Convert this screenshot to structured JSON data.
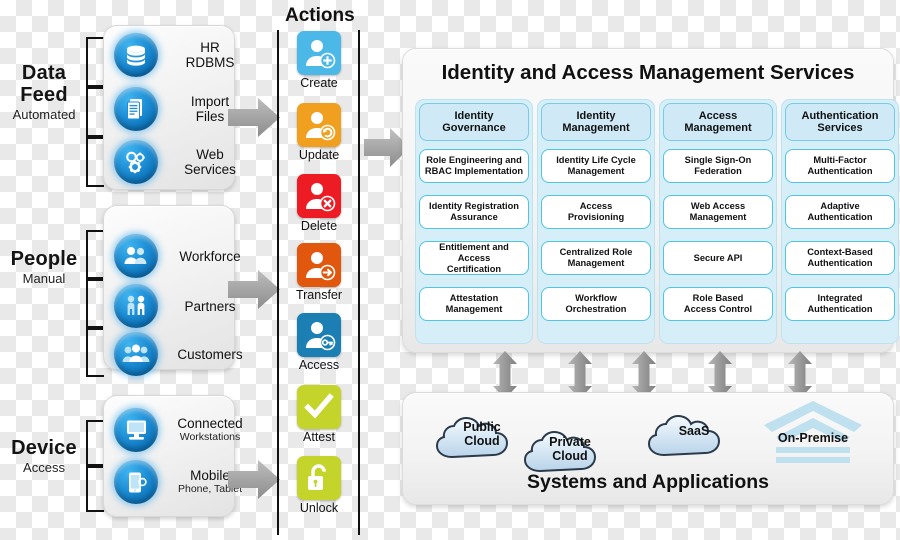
{
  "sources": [
    {
      "label": "Data Feed",
      "sublabel": "Automated",
      "items": [
        {
          "name": "HR RDBMS",
          "line1": "HR",
          "line2": "RDBMS",
          "icon": "database-icon"
        },
        {
          "name": "Import Files",
          "line1": "Import",
          "line2": "Files",
          "icon": "document-icon"
        },
        {
          "name": "Web Services",
          "line1": "Web",
          "line2": "Services",
          "icon": "gears-icon"
        }
      ]
    },
    {
      "label": "People",
      "sublabel": "Manual",
      "items": [
        {
          "name": "Workforce",
          "line1": "Workforce",
          "line2": "",
          "icon": "group-icon"
        },
        {
          "name": "Partners",
          "line1": "Partners",
          "line2": "",
          "icon": "handshake-icon"
        },
        {
          "name": "Customers",
          "line1": "Customers",
          "line2": "",
          "icon": "customers-icon"
        }
      ]
    },
    {
      "label": "Device",
      "sublabel": "Access",
      "items": [
        {
          "name": "Connected Workstations",
          "line1": "Connected",
          "line2": "Workstations",
          "icon": "workstation-icon"
        },
        {
          "name": "Mobile",
          "line1": "Mobile",
          "line2": "Phone, Tablet",
          "icon": "mobile-icon"
        }
      ]
    }
  ],
  "actions": {
    "title": "Actions",
    "items": [
      {
        "label": "Create",
        "icon": "user-add-icon",
        "color": "#4cb8e8"
      },
      {
        "label": "Update",
        "icon": "user-refresh-icon",
        "color": "#f0a01e"
      },
      {
        "label": "Delete",
        "icon": "user-delete-icon",
        "color": "#ed1c24"
      },
      {
        "label": "Transfer",
        "icon": "user-transfer-icon",
        "color": "#e2570e"
      },
      {
        "label": "Access",
        "icon": "user-key-icon",
        "color": "#1b7fb4"
      },
      {
        "label": "Attest",
        "icon": "checkmark-icon",
        "color": "#c4d42a"
      },
      {
        "label": "Unlock",
        "icon": "open-padlock-icon",
        "color": "#c4d42a"
      }
    ]
  },
  "iam": {
    "title": "Identity and Access Management Services",
    "columns": [
      {
        "head_line1": "Identity",
        "head_line2": "Governance",
        "services": [
          {
            "line1": "Role Engineering and",
            "line2": "RBAC Implementation"
          },
          {
            "line1": "Identity Registration",
            "line2": "Assurance"
          },
          {
            "line1": "Entitlement and Access",
            "line2": "Certification"
          },
          {
            "line1": "Attestation",
            "line2": "Management"
          }
        ]
      },
      {
        "head_line1": "Identity",
        "head_line2": "Management",
        "services": [
          {
            "line1": "Identity Life Cycle",
            "line2": "Management"
          },
          {
            "line1": "Access",
            "line2": "Provisioning"
          },
          {
            "line1": "Centralized Role",
            "line2": "Management"
          },
          {
            "line1": "Workflow",
            "line2": "Orchestration"
          }
        ]
      },
      {
        "head_line1": "Access",
        "head_line2": "Management",
        "services": [
          {
            "line1": "Single Sign-On",
            "line2": "Federation"
          },
          {
            "line1": "Web Access",
            "line2": "Management"
          },
          {
            "line1": "Secure API",
            "line2": ""
          },
          {
            "line1": "Role Based",
            "line2": "Access Control"
          }
        ]
      },
      {
        "head_line1": "Authentication",
        "head_line2": "Services",
        "services": [
          {
            "line1": "Multi-Factor",
            "line2": "Authentication"
          },
          {
            "line1": "Adaptive",
            "line2": "Authentication"
          },
          {
            "line1": "Context-Based",
            "line2": "Authentication"
          },
          {
            "line1": "Integrated",
            "line2": "Authentication"
          }
        ]
      }
    ]
  },
  "systems": {
    "title": "Systems and Applications",
    "nodes": [
      {
        "name": "public-cloud",
        "line1": "Public",
        "line2": "Cloud",
        "icon": "cloud-icon"
      },
      {
        "name": "private-cloud",
        "line1": "Private",
        "line2": "Cloud",
        "icon": "cloud-icon"
      },
      {
        "name": "saas",
        "line1": "SaaS",
        "line2": "",
        "icon": "cloud-icon"
      },
      {
        "name": "on-premise",
        "line1": "On-Premise",
        "line2": "",
        "icon": "building-icon"
      }
    ]
  },
  "colors": {
    "accent_blue": "#1e8fd6",
    "panel_blue": "#d6eef7",
    "service_border": "#4fc3e8",
    "arrow_gray": "#9c9c9c"
  }
}
